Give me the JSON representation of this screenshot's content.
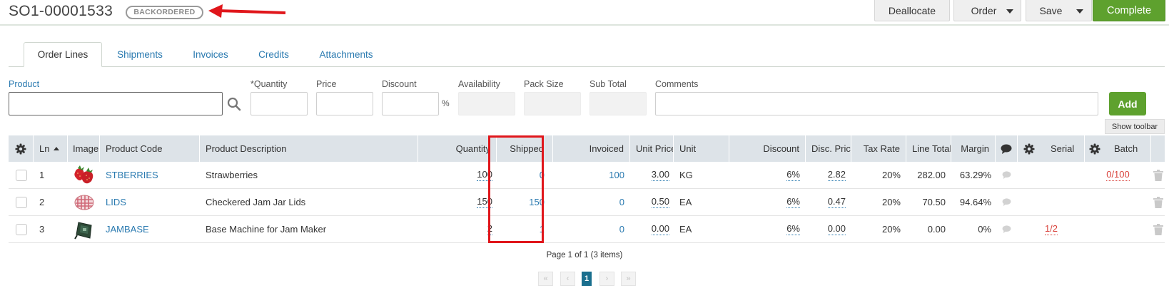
{
  "header": {
    "order_number": "SO1-00001533",
    "status": "BACKORDERED",
    "buttons": {
      "deallocate": "Deallocate",
      "order": "Order",
      "save": "Save",
      "complete": "Complete"
    }
  },
  "tabs": [
    "Order Lines",
    "Shipments",
    "Invoices",
    "Credits",
    "Attachments"
  ],
  "form": {
    "labels": {
      "product": "Product",
      "quantity": "*Quantity",
      "price": "Price",
      "discount": "Discount",
      "percent": "%",
      "availability": "Availability",
      "pack_size": "Pack Size",
      "sub_total": "Sub Total",
      "comments": "Comments"
    },
    "add": "Add",
    "show_toolbar": "Show toolbar"
  },
  "grid": {
    "columns": {
      "ln": "Ln",
      "image": "Image",
      "code": "Product Code",
      "desc": "Product Description",
      "qty": "Quantity",
      "shipped": "Shipped",
      "invoiced": "Invoiced",
      "unit_price": "Unit Price",
      "unit": "Unit",
      "discount": "Discount",
      "disc_price": "Disc. Price",
      "tax_rate": "Tax Rate",
      "line_total": "Line Total",
      "margin": "Margin",
      "serial": "Serial",
      "batch": "Batch"
    },
    "rows": [
      {
        "ln": "1",
        "icon": "strawberry-icon",
        "code": "STBERRIES",
        "desc": "Strawberries",
        "qty": "100",
        "shipped": "0",
        "invoiced": "100",
        "unit_price": "3.00",
        "unit": "KG",
        "discount": "6%",
        "disc_price": "2.82",
        "tax_rate": "20%",
        "line_total": "282.00",
        "margin": "63.29%",
        "serial": "",
        "batch": "0/100"
      },
      {
        "ln": "2",
        "icon": "jar-lid-icon",
        "code": "LIDS",
        "desc": "Checkered Jam Jar Lids",
        "qty": "150",
        "shipped": "150",
        "invoiced": "0",
        "unit_price": "0.50",
        "unit": "EA",
        "discount": "6%",
        "disc_price": "0.47",
        "tax_rate": "20%",
        "line_total": "70.50",
        "margin": "94.64%",
        "serial": "",
        "batch": ""
      },
      {
        "ln": "3",
        "icon": "machine-base-icon",
        "code": "JAMBASE",
        "desc": "Base Machine for Jam Maker",
        "qty": "2",
        "shipped": "1",
        "invoiced": "0",
        "unit_price": "0.00",
        "unit": "EA",
        "discount": "6%",
        "disc_price": "0.00",
        "tax_rate": "20%",
        "line_total": "0.00",
        "margin": "0%",
        "serial": "1/2",
        "batch": ""
      }
    ]
  },
  "pager": {
    "info": "Page 1 of 1 (3 items)",
    "current": "1"
  },
  "colors": {
    "accent_green": "#5ea12e",
    "link_blue": "#2a7ab0",
    "header_gray": "#dde3e8",
    "annotation_red": "#e0161b",
    "alert_red": "#d9423b"
  }
}
